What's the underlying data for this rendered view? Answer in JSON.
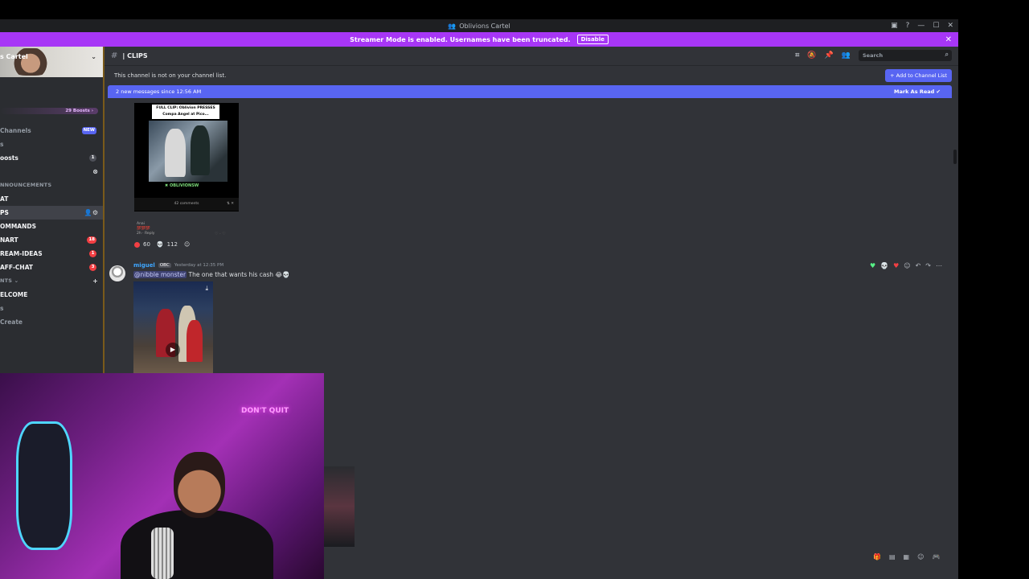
{
  "window": {
    "title": "Oblivions Cartel"
  },
  "streamer_banner": {
    "text": "Streamer Mode is enabled. Usernames have been truncated.",
    "disable_label": "Disable"
  },
  "sidebar": {
    "server_name": "s Cartel",
    "boost_text": "29 Boosts ›",
    "rows": [
      {
        "label": "Channels",
        "badge": "NEW",
        "badge_type": "new"
      },
      {
        "label": "s",
        "badge": ""
      },
      {
        "label": "oosts",
        "badge": "1"
      },
      {
        "label": "",
        "badge": ""
      },
      {
        "label": "NNOUNCEMENTS",
        "badge": ""
      },
      {
        "label": "AT",
        "badge": ""
      },
      {
        "label": "PS",
        "badge": ""
      },
      {
        "label": "OMMANDS",
        "badge": ""
      },
      {
        "label": "NART",
        "badge": "18"
      },
      {
        "label": "REAM-IDEAS",
        "badge": "1"
      },
      {
        "label": "AFF-CHAT",
        "badge": "3"
      },
      {
        "label": "NTS ⌄",
        "badge": ""
      },
      {
        "label": "ELCOME",
        "badge": ""
      },
      {
        "label": "s",
        "badge": ""
      },
      {
        "label": "Create",
        "badge": ""
      }
    ]
  },
  "channel": {
    "name": "| CLIPS",
    "search_placeholder": "Search"
  },
  "notice": {
    "text": "This channel is not on your channel list.",
    "add_label": "+ Add to Channel List"
  },
  "new_messages": {
    "text": "2 new messages since 12:56 AM",
    "mark_label": "Mark As Read"
  },
  "clip": {
    "banner": "FULL CLIP: Oblivion PRESSES Compa Angel at Pico...",
    "brand": "OBLIVIONSW",
    "meta": "42 comments",
    "comment_user": "Anai",
    "comment_text": "💯💯💯",
    "comment_time": "2h · Reply"
  },
  "reactions": [
    {
      "count": "60",
      "color": "#f23f43"
    },
    {
      "count": "112",
      "color": "#dbdee1"
    }
  ],
  "message": {
    "username": "miguel",
    "tag": "OBC",
    "time": "Yesterday at 12:35 PM",
    "mention": "@nibble monster",
    "text": "The one that wants his cash 😂💀"
  },
  "webcam_sign": "DON'T QUIT",
  "colors": {
    "accent": "#5865f2",
    "streamer": "#a736f6",
    "bg": "#313338",
    "sidebar": "#2b2d31"
  }
}
